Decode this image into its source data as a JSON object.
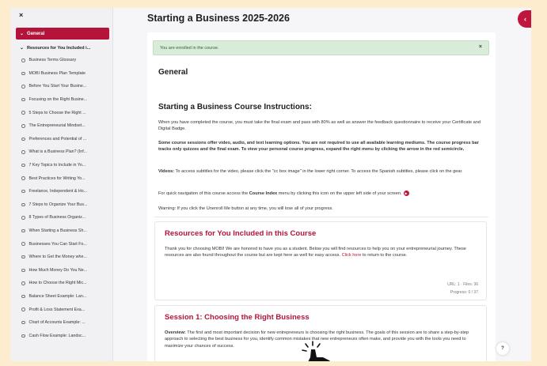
{
  "sidebar": {
    "close_label": "×",
    "section_general": "General",
    "section_resources": "Resources for You Included i...",
    "items": [
      {
        "label": "Business Terms Glossary"
      },
      {
        "label": "MOBI Business Plan Template"
      },
      {
        "label": "Before You Start Your Busine..."
      },
      {
        "label": "Focusing on the Right Busine..."
      },
      {
        "label": "5 Steps to Choose the Right ..."
      },
      {
        "label": "The Entrepreneurial Mindset..."
      },
      {
        "label": "Preferences and Potential of ..."
      },
      {
        "label": "What is a Business Plan? (Inf..."
      },
      {
        "label": "7 Key Topics to Include in Yo..."
      },
      {
        "label": "Best Practices for Writing Yo..."
      },
      {
        "label": "Freelance, Independent & Ho..."
      },
      {
        "label": "7 Steps to Organize Your Bus..."
      },
      {
        "label": "8 Types of Business Organiz..."
      },
      {
        "label": "When Starting a Business Sh..."
      },
      {
        "label": "Businesses You Can Start Fo..."
      },
      {
        "label": "Where to Get the Money whe..."
      },
      {
        "label": "How Much Money Do You Ne..."
      },
      {
        "label": "How to Choose the Right Mic..."
      },
      {
        "label": "Balance Sheet Example: Lan..."
      },
      {
        "label": "Profit & Loss Statement Exa..."
      },
      {
        "label": "Chart of Accounts Example: ..."
      },
      {
        "label": "Cash Flow Example: Landsc..."
      }
    ]
  },
  "main": {
    "course_title": "Starting a Business 2025-2026",
    "course_index_label": "‹",
    "alert_text": "You are enrolled in the course.",
    "alert_close": "×",
    "general_heading": "General",
    "instructions_heading": "Starting a Business Course Instructions:",
    "p1": "When you have completed the course, you must take the final exam and pass with 80% as well as answer the feedback questionnaire to receive your Certificate and Digital Badge.",
    "p2": "Some course sessions offer video, audio, and text learning options. You are not required to use all available learning mediums. The course progress bar tracks only quizzes and the final exam. To view your personal course progress, expand the right menu by clicking the arrow in the red semicircle.",
    "p3_label": "Videos:",
    "p3_text": " To access subtitles for the video, please click the \"cc box image\" in the lower right corner. To access the Spanish subtitles, please click on the gear.",
    "p4_pre": "For quick navigation of this course access the ",
    "p4_bold": "Course Index",
    "p4_post": " menu by clicking this icon on the upper left side of your screen.",
    "p5": "Warning: If you click the Unenroll Me button at any time, you will lose all of your progress.",
    "resources": {
      "title": "Resources for You Included in this Course",
      "text": "Thank you for choosing MOBI! We are honored to have you as a student.  Below you will find resources to help you on your entrepreneurial journey.  These resources are also found throughout the course but are kept here as well for easy access. ",
      "link": "Click here",
      "text_after": " to return to the course.",
      "url_files": "URL: 1 · Files: 36",
      "progress": "Progress: 0 / 37"
    },
    "session1": {
      "title": "Session 1: Choosing the Right Business",
      "label": "Overview:",
      "text": " The first and most important decision for new entrepreneurs is choosing the right business. The goals of this session are to share a step-by-step approach to selecting the best business for you, identify common mistakes that new entrepreneurs often make, and provide you with the tools you need to maximize your chances of success."
    }
  },
  "help_label": "?",
  "colors": {
    "accent": "#b5143a",
    "alert_bg": "#d9ecd9",
    "page_bg": "#fdeccd"
  },
  "icons": [
    "close-icon",
    "chevron-down-icon",
    "circle-icon",
    "course-index-icon",
    "help-icon",
    "pointer-hand-icon"
  ]
}
